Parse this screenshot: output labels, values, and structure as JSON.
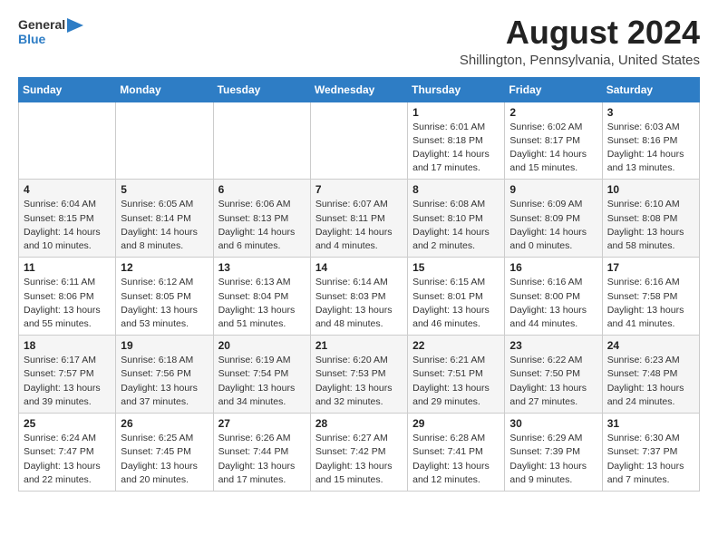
{
  "header": {
    "logo_general": "General",
    "logo_blue": "Blue",
    "main_title": "August 2024",
    "subtitle": "Shillington, Pennsylvania, United States"
  },
  "calendar": {
    "days_of_week": [
      "Sunday",
      "Monday",
      "Tuesday",
      "Wednesday",
      "Thursday",
      "Friday",
      "Saturday"
    ],
    "weeks": [
      [
        {
          "day": "",
          "info": ""
        },
        {
          "day": "",
          "info": ""
        },
        {
          "day": "",
          "info": ""
        },
        {
          "day": "",
          "info": ""
        },
        {
          "day": "1",
          "info": "Sunrise: 6:01 AM\nSunset: 8:18 PM\nDaylight: 14 hours\nand 17 minutes."
        },
        {
          "day": "2",
          "info": "Sunrise: 6:02 AM\nSunset: 8:17 PM\nDaylight: 14 hours\nand 15 minutes."
        },
        {
          "day": "3",
          "info": "Sunrise: 6:03 AM\nSunset: 8:16 PM\nDaylight: 14 hours\nand 13 minutes."
        }
      ],
      [
        {
          "day": "4",
          "info": "Sunrise: 6:04 AM\nSunset: 8:15 PM\nDaylight: 14 hours\nand 10 minutes."
        },
        {
          "day": "5",
          "info": "Sunrise: 6:05 AM\nSunset: 8:14 PM\nDaylight: 14 hours\nand 8 minutes."
        },
        {
          "day": "6",
          "info": "Sunrise: 6:06 AM\nSunset: 8:13 PM\nDaylight: 14 hours\nand 6 minutes."
        },
        {
          "day": "7",
          "info": "Sunrise: 6:07 AM\nSunset: 8:11 PM\nDaylight: 14 hours\nand 4 minutes."
        },
        {
          "day": "8",
          "info": "Sunrise: 6:08 AM\nSunset: 8:10 PM\nDaylight: 14 hours\nand 2 minutes."
        },
        {
          "day": "9",
          "info": "Sunrise: 6:09 AM\nSunset: 8:09 PM\nDaylight: 14 hours\nand 0 minutes."
        },
        {
          "day": "10",
          "info": "Sunrise: 6:10 AM\nSunset: 8:08 PM\nDaylight: 13 hours\nand 58 minutes."
        }
      ],
      [
        {
          "day": "11",
          "info": "Sunrise: 6:11 AM\nSunset: 8:06 PM\nDaylight: 13 hours\nand 55 minutes."
        },
        {
          "day": "12",
          "info": "Sunrise: 6:12 AM\nSunset: 8:05 PM\nDaylight: 13 hours\nand 53 minutes."
        },
        {
          "day": "13",
          "info": "Sunrise: 6:13 AM\nSunset: 8:04 PM\nDaylight: 13 hours\nand 51 minutes."
        },
        {
          "day": "14",
          "info": "Sunrise: 6:14 AM\nSunset: 8:03 PM\nDaylight: 13 hours\nand 48 minutes."
        },
        {
          "day": "15",
          "info": "Sunrise: 6:15 AM\nSunset: 8:01 PM\nDaylight: 13 hours\nand 46 minutes."
        },
        {
          "day": "16",
          "info": "Sunrise: 6:16 AM\nSunset: 8:00 PM\nDaylight: 13 hours\nand 44 minutes."
        },
        {
          "day": "17",
          "info": "Sunrise: 6:16 AM\nSunset: 7:58 PM\nDaylight: 13 hours\nand 41 minutes."
        }
      ],
      [
        {
          "day": "18",
          "info": "Sunrise: 6:17 AM\nSunset: 7:57 PM\nDaylight: 13 hours\nand 39 minutes."
        },
        {
          "day": "19",
          "info": "Sunrise: 6:18 AM\nSunset: 7:56 PM\nDaylight: 13 hours\nand 37 minutes."
        },
        {
          "day": "20",
          "info": "Sunrise: 6:19 AM\nSunset: 7:54 PM\nDaylight: 13 hours\nand 34 minutes."
        },
        {
          "day": "21",
          "info": "Sunrise: 6:20 AM\nSunset: 7:53 PM\nDaylight: 13 hours\nand 32 minutes."
        },
        {
          "day": "22",
          "info": "Sunrise: 6:21 AM\nSunset: 7:51 PM\nDaylight: 13 hours\nand 29 minutes."
        },
        {
          "day": "23",
          "info": "Sunrise: 6:22 AM\nSunset: 7:50 PM\nDaylight: 13 hours\nand 27 minutes."
        },
        {
          "day": "24",
          "info": "Sunrise: 6:23 AM\nSunset: 7:48 PM\nDaylight: 13 hours\nand 24 minutes."
        }
      ],
      [
        {
          "day": "25",
          "info": "Sunrise: 6:24 AM\nSunset: 7:47 PM\nDaylight: 13 hours\nand 22 minutes."
        },
        {
          "day": "26",
          "info": "Sunrise: 6:25 AM\nSunset: 7:45 PM\nDaylight: 13 hours\nand 20 minutes."
        },
        {
          "day": "27",
          "info": "Sunrise: 6:26 AM\nSunset: 7:44 PM\nDaylight: 13 hours\nand 17 minutes."
        },
        {
          "day": "28",
          "info": "Sunrise: 6:27 AM\nSunset: 7:42 PM\nDaylight: 13 hours\nand 15 minutes."
        },
        {
          "day": "29",
          "info": "Sunrise: 6:28 AM\nSunset: 7:41 PM\nDaylight: 13 hours\nand 12 minutes."
        },
        {
          "day": "30",
          "info": "Sunrise: 6:29 AM\nSunset: 7:39 PM\nDaylight: 13 hours\nand 9 minutes."
        },
        {
          "day": "31",
          "info": "Sunrise: 6:30 AM\nSunset: 7:37 PM\nDaylight: 13 hours\nand 7 minutes."
        }
      ]
    ]
  }
}
